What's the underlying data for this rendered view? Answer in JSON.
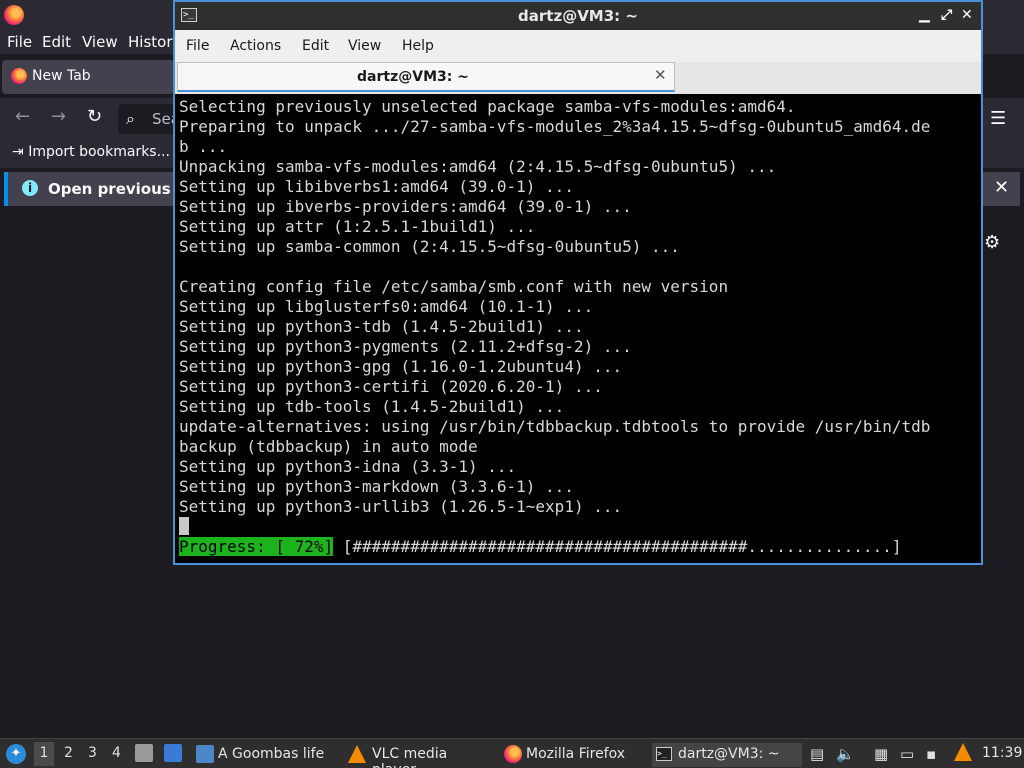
{
  "firefox": {
    "menu": [
      "File",
      "Edit",
      "View",
      "History"
    ],
    "tab_title": "New Tab",
    "url_placeholder": "Sea",
    "import_bookmarks": "Import bookmarks...",
    "notification": "Open previous ta"
  },
  "terminal": {
    "window_title": "dartz@VM3: ~",
    "menu": [
      "File",
      "Actions",
      "Edit",
      "View",
      "Help"
    ],
    "tab_label": "dartz@VM3: ~",
    "lines": [
      "Selecting previously unselected package samba-vfs-modules:amd64.",
      "Preparing to unpack .../27-samba-vfs-modules_2%3a4.15.5~dfsg-0ubuntu5_amd64.de",
      "b ...",
      "Unpacking samba-vfs-modules:amd64 (2:4.15.5~dfsg-0ubuntu5) ...",
      "Setting up libibverbs1:amd64 (39.0-1) ...",
      "Setting up ibverbs-providers:amd64 (39.0-1) ...",
      "Setting up attr (1:2.5.1-1build1) ...",
      "Setting up samba-common (2:4.15.5~dfsg-0ubuntu5) ...",
      "",
      "Creating config file /etc/samba/smb.conf with new version",
      "Setting up libglusterfs0:amd64 (10.1-1) ...",
      "Setting up python3-tdb (1.4.5-2build1) ...",
      "Setting up python3-pygments (2.11.2+dfsg-2) ...",
      "Setting up python3-gpg (1.16.0-1.2ubuntu4) ...",
      "Setting up python3-certifi (2020.6.20-1) ...",
      "Setting up tdb-tools (1.4.5-2build1) ...",
      "update-alternatives: using /usr/bin/tdbbackup.tdbtools to provide /usr/bin/tdb",
      "backup (tdbbackup) in auto mode",
      "Setting up python3-idna (3.3-1) ...",
      "Setting up python3-markdown (3.3.6-1) ...",
      "Setting up python3-urllib3 (1.26.5-1~exp1) ..."
    ],
    "progress_label": "Progress: [ 72%]",
    "progress_bar": " [#########################################...............]",
    "progress_percent": 72
  },
  "taskbar": {
    "workspaces": [
      "1",
      "2",
      "3",
      "4"
    ],
    "items": [
      {
        "icon": "folder-icon",
        "label": "A Goombas life"
      },
      {
        "icon": "vlc-icon",
        "label": "VLC media player"
      },
      {
        "icon": "firefox-icon",
        "label": "Mozilla Firefox"
      },
      {
        "icon": "terminal-icon",
        "label": "dartz@VM3: ~"
      }
    ],
    "clock": "11:39"
  },
  "colors": {
    "terminal_accent": "#4a90d9",
    "progress_green": "#1db31d",
    "terminal_bg": "#000000"
  }
}
